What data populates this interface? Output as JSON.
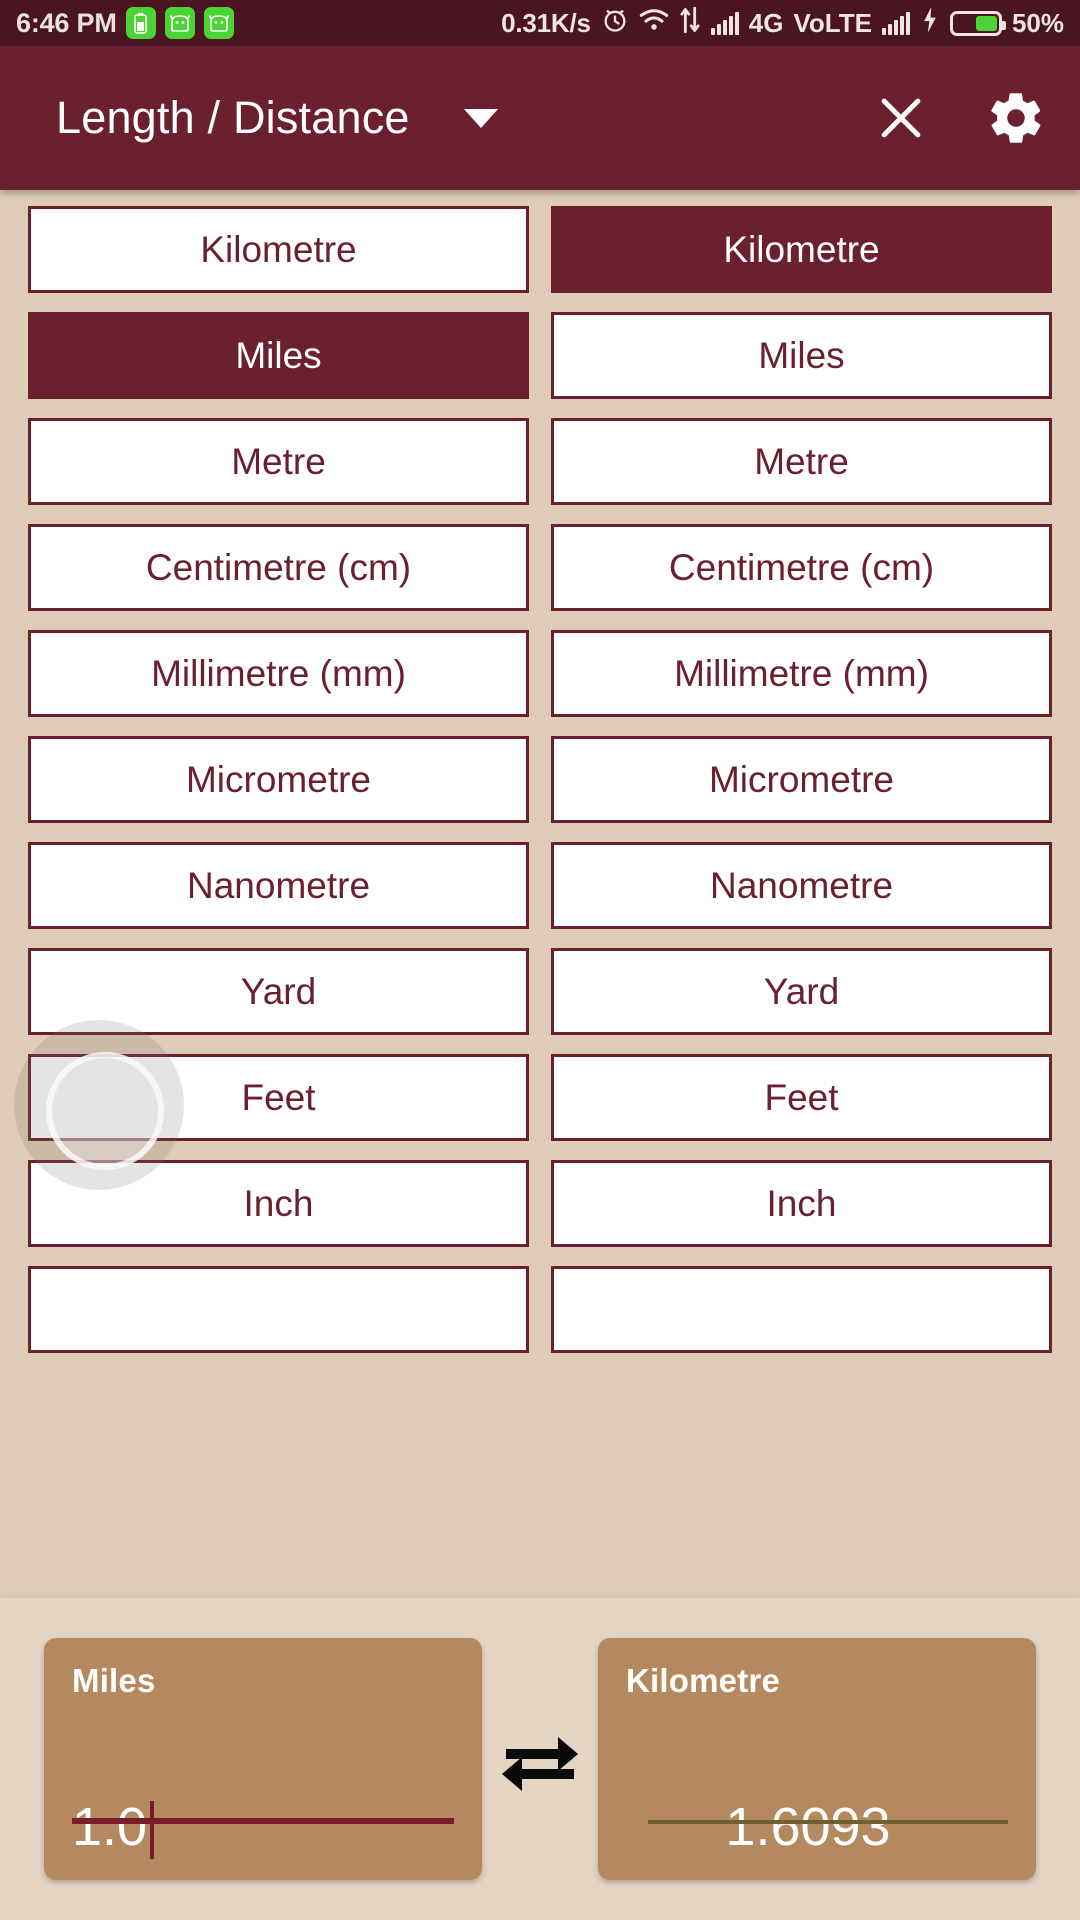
{
  "statusbar": {
    "time": "6:46 PM",
    "network_speed": "0.31K/s",
    "network_type": "4G",
    "volte": "VoLTE",
    "battery_percent": "50%",
    "icons": [
      "battery-green-icon",
      "android-face-icon",
      "android-face-icon",
      "alarm-icon",
      "wifi-icon",
      "data-transfer-icon",
      "signal-bars-icon",
      "signal-bars-icon",
      "charging-bolt-icon",
      "battery-icon"
    ]
  },
  "appbar": {
    "title": "Length / Distance",
    "dropdown_icon": "chevron-down-icon",
    "close_icon": "close-icon",
    "settings_icon": "gear-icon"
  },
  "units": {
    "left_column": [
      {
        "label": "Kilometre",
        "selected": false
      },
      {
        "label": "Miles",
        "selected": true
      },
      {
        "label": "Metre",
        "selected": false
      },
      {
        "label": "Centimetre (cm)",
        "selected": false
      },
      {
        "label": "Millimetre (mm)",
        "selected": false
      },
      {
        "label": "Micrometre",
        "selected": false
      },
      {
        "label": "Nanometre",
        "selected": false
      },
      {
        "label": "Yard",
        "selected": false
      },
      {
        "label": "Feet",
        "selected": false
      },
      {
        "label": "Inch",
        "selected": false
      },
      {
        "label": "",
        "selected": false
      }
    ],
    "right_column": [
      {
        "label": "Kilometre",
        "selected": true
      },
      {
        "label": "Miles",
        "selected": false
      },
      {
        "label": "Metre",
        "selected": false
      },
      {
        "label": "Centimetre (cm)",
        "selected": false
      },
      {
        "label": "Millimetre (mm)",
        "selected": false
      },
      {
        "label": "Micrometre",
        "selected": false
      },
      {
        "label": "Nanometre",
        "selected": false
      },
      {
        "label": "Yard",
        "selected": false
      },
      {
        "label": "Feet",
        "selected": false
      },
      {
        "label": "Inch",
        "selected": false
      },
      {
        "label": "",
        "selected": false
      }
    ]
  },
  "conversion": {
    "from_label": "Miles",
    "from_value": "1.0",
    "to_label": "Kilometre",
    "to_value": "1.6093",
    "swap_icon": "swap-horizontal-icon"
  },
  "colors": {
    "primary": "#6B2030",
    "statusbar": "#4A1420",
    "background": "#DFCCB8",
    "panel": "#E4D4C4",
    "card": "#B5895F",
    "accent_green": "#4CD437"
  }
}
